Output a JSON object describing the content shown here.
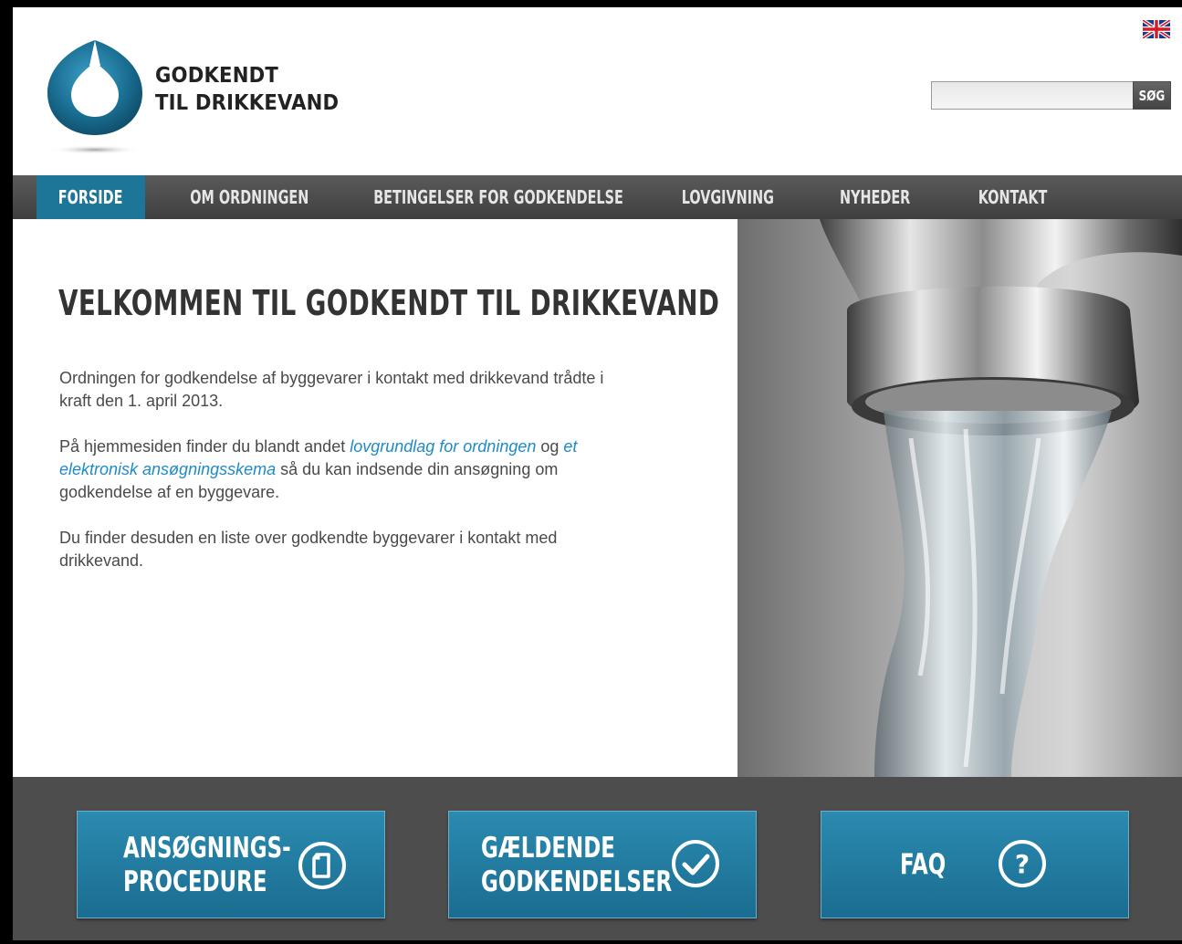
{
  "header": {
    "logo_line1": "GODKENDT",
    "logo_line2": "TIL DRIKKEVAND",
    "language_flag": "uk-flag-icon",
    "search": {
      "value": "",
      "placeholder": "",
      "button_label": "SØG"
    }
  },
  "nav": {
    "items": [
      {
        "label": "FORSIDE",
        "active": true
      },
      {
        "label": "OM ORDNINGEN",
        "active": false
      },
      {
        "label": "BETINGELSER FOR GODKENDELSE",
        "active": false
      },
      {
        "label": "LOVGIVNING",
        "active": false
      },
      {
        "label": "NYHEDER",
        "active": false
      },
      {
        "label": "KONTAKT",
        "active": false
      }
    ]
  },
  "main": {
    "title": "VELKOMMEN TIL GODKENDT TIL DRIKKEVAND",
    "p1": "Ordningen for godkendelse af byggevarer i kontakt med drikkevand trådte i kraft den 1. april 2013.",
    "p2_pre": "På hjemmesiden finder du blandt andet ",
    "p2_link1": "lovgrundlag for ordningen",
    "p2_mid": " og ",
    "p2_link2": "et elektronisk ansøgningsskema",
    "p2_post": " så du kan indsende din ansøgning om godkendelse af en byggevare.",
    "p3": "Du finder desuden en liste over godkendte byggevarer i kontakt med drikkevand."
  },
  "footer": {
    "tiles": [
      {
        "line1": "ANSØGNINGS-",
        "line2": "PROCEDURE",
        "icon": "document-icon"
      },
      {
        "line1": "GÆLDENDE",
        "line2": "GODKENDELSER",
        "icon": "checkmark-icon"
      },
      {
        "line1": "FAQ",
        "line2": "",
        "icon": "question-icon"
      }
    ]
  },
  "colors": {
    "brand_blue": "#1d7597",
    "link_blue": "#1f8ac8",
    "nav_dark": "#4a4a4a",
    "footer_dark": "#4d4d4d"
  }
}
